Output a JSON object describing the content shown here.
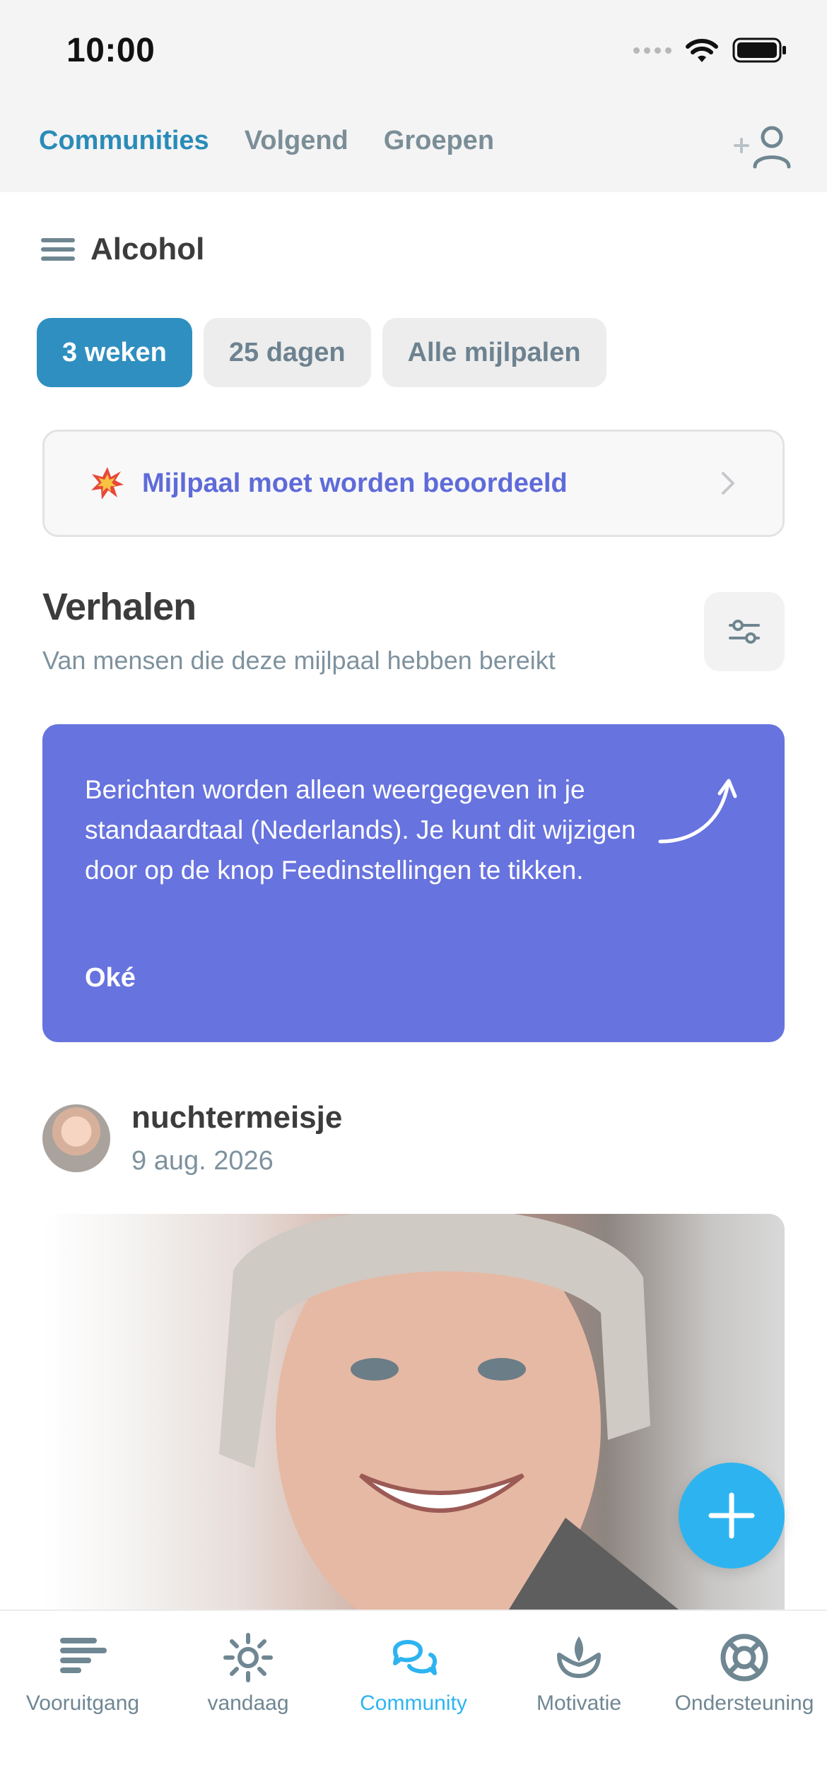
{
  "status_bar": {
    "time": "10:00"
  },
  "top_nav": {
    "tabs": [
      {
        "label": "Communities",
        "active": true
      },
      {
        "label": "Volgend",
        "active": false
      },
      {
        "label": "Groepen",
        "active": false
      }
    ],
    "add_user_icon": "add-user-icon"
  },
  "section": {
    "title": "Alcohol",
    "menu_icon": "menu-icon"
  },
  "milestones": [
    {
      "label": "3 weken",
      "active": true
    },
    {
      "label": "25 dagen",
      "active": false
    },
    {
      "label": "Alle mijlpalen",
      "active": false
    }
  ],
  "review_banner": {
    "text": "Mijlpaal moet worden beoordeeld",
    "icon": "burst-icon"
  },
  "stories": {
    "title": "Verhalen",
    "subtitle": "Van mensen die deze mijlpaal hebben bereikt",
    "filter_icon": "filter-icon"
  },
  "info_card": {
    "text": "Berichten worden alleen weergegeven in je standaardtaal (Nederlands). Je kunt dit wijzigen door op de knop Feedinstellingen te tikken.",
    "ok_label": "Oké"
  },
  "post": {
    "username": "nuchtermeisje",
    "date": "9 aug. 2026"
  },
  "bottom_nav": [
    {
      "label": "Vooruitgang",
      "icon": "progress-icon",
      "active": false
    },
    {
      "label": "vandaag",
      "icon": "sun-icon",
      "active": false
    },
    {
      "label": "Community",
      "icon": "community-icon",
      "active": true
    },
    {
      "label": "Motivatie",
      "icon": "lotus-icon",
      "active": false
    },
    {
      "label": "Ondersteuning",
      "icon": "lifebuoy-icon",
      "active": false
    }
  ],
  "colors": {
    "accent": "#2a8bb8",
    "chip_active": "#2f8fc0",
    "info_card": "#6773de",
    "review_text": "#5f6bd9",
    "fab": "#2db4f0"
  }
}
